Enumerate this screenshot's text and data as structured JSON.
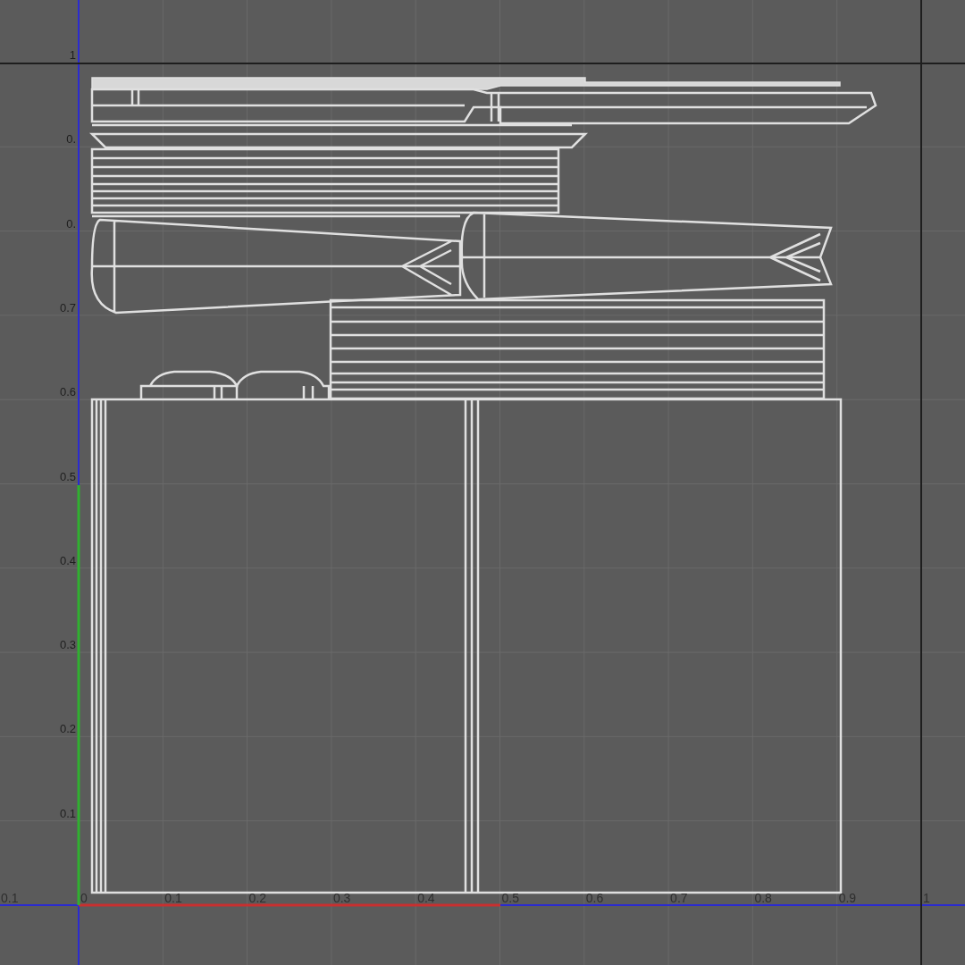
{
  "uv_editor": {
    "u_tick_labels": [
      "0.1",
      "0",
      "0.1",
      "0.2",
      "0.3",
      "0.4",
      "0.5",
      "0.6",
      "0.7",
      "0.8",
      "0.9",
      "1"
    ],
    "v_tick_labels": [
      "1",
      "0.",
      "0.",
      "0.7",
      "0.6",
      "0.5",
      "0.4",
      "0.3",
      "0.2",
      "0.1"
    ]
  }
}
